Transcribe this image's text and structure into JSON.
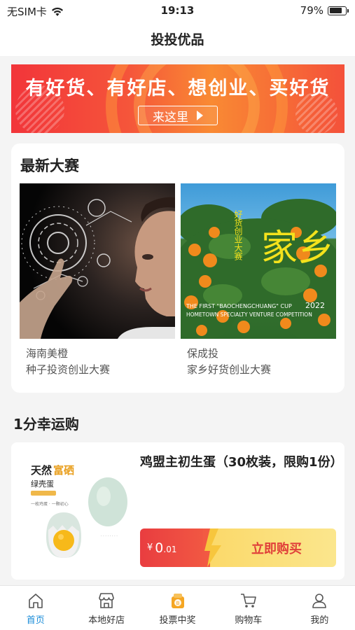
{
  "status_bar": {
    "carrier": "无SIM卡",
    "time": "19:13",
    "battery_percent": "79%",
    "battery_level": 0.79
  },
  "nav": {
    "title": "投投优品"
  },
  "banner": {
    "headline": "有好货、有好店、想创业、买好货",
    "cta": "来这里"
  },
  "latest_contests": {
    "title": "最新大赛",
    "items": [
      {
        "org": "海南美橙",
        "name": "种子投资创业大赛",
        "image": "ai-woman-hologram"
      },
      {
        "org": "保成投",
        "name": "家乡好货创业大赛",
        "image": "orange-tree",
        "poster_big": "家乡",
        "poster_small": "好货创业大赛",
        "poster_caption1": "THE FIRST \"BAOCHENGCHUANG\" CUP",
        "poster_year": "2022",
        "poster_caption2": "HOMETOWN SPECIALTY VENTURE COMPETITION"
      }
    ]
  },
  "lucky_buy": {
    "title": "1分幸运购",
    "product": {
      "name": "鸡盟主初生蛋（30枚装，限购1份）",
      "currency": "¥",
      "price_int": "0",
      "price_dec": ".01",
      "buy_label": "立即购买",
      "img_brand1": "天然",
      "img_brand2": "富硒",
      "img_brand3": "绿壳蛋",
      "img_line1": "一枚鸡蛋 · 一颗初心"
    }
  },
  "tabbar": {
    "items": [
      {
        "label": "首页",
        "icon": "home-icon",
        "active": true
      },
      {
        "label": "本地好店",
        "icon": "store-icon",
        "active": false
      },
      {
        "label": "投票中奖",
        "icon": "vote-icon",
        "active": false
      },
      {
        "label": "购物车",
        "icon": "cart-icon",
        "active": false
      },
      {
        "label": "我的",
        "icon": "user-icon",
        "active": false
      }
    ]
  },
  "colors": {
    "accent": "#1a8cd8",
    "banner_red": "#f2353a",
    "buy_red": "#e93d40",
    "buy_yellow": "#fbd96a"
  }
}
